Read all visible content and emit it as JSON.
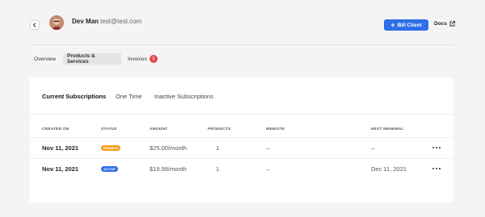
{
  "header": {
    "user_name": "Dev Man",
    "user_email": "test@test.com",
    "bill_client_label": "Bill Client",
    "docs_label": "Docs"
  },
  "tabs": [
    {
      "label": "Overview",
      "active": false
    },
    {
      "label": "Products & Services",
      "active": true
    },
    {
      "label": "Invoices",
      "active": false,
      "badge": "1"
    }
  ],
  "subtabs": [
    {
      "label": "Current Subscriptions",
      "active": true
    },
    {
      "label": "One Time",
      "active": false
    },
    {
      "label": "Inactive Subscriptions",
      "active": false
    }
  ],
  "table": {
    "columns": [
      "CREATED ON",
      "STATUS",
      "AMOUNT",
      "PRODUCTS",
      "WEBSITE",
      "NEXT RENEWAL"
    ],
    "rows": [
      {
        "created_on": "Nov 11, 2021",
        "status": "PENDING",
        "status_color": "#f0a020",
        "amount": "$25.00/month",
        "products": "1",
        "website": "–",
        "next_renewal": "–"
      },
      {
        "created_on": "Nov 11, 2021",
        "status": "ACTIVE",
        "status_color": "#2f6fe8",
        "amount": "$19.99/month",
        "products": "1",
        "website": "–",
        "next_renewal": "Dec 11, 2021"
      }
    ]
  },
  "colors": {
    "accent": "#2f6fe8",
    "badge": "#e5484d",
    "pending": "#f0a020"
  }
}
